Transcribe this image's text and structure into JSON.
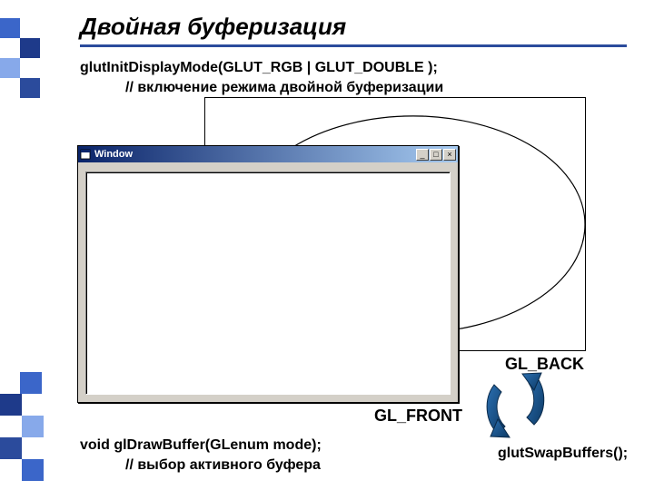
{
  "title": "Двойная буферизация",
  "code": {
    "init_line": "glutInitDisplayMode(GLUT_RGB | GLUT_DOUBLE );",
    "init_comment": "// включение режима двойной буферизации",
    "draw_line": "void glDrawBuffer(GLenum mode);",
    "draw_comment": "// выбор активного буфера",
    "swap_call": "glutSwapBuffers();"
  },
  "labels": {
    "back": "GL_BACK",
    "front": "GL_FRONT"
  },
  "window": {
    "title": "Window",
    "btn_min": "_",
    "btn_max": "□",
    "btn_close": "×"
  }
}
